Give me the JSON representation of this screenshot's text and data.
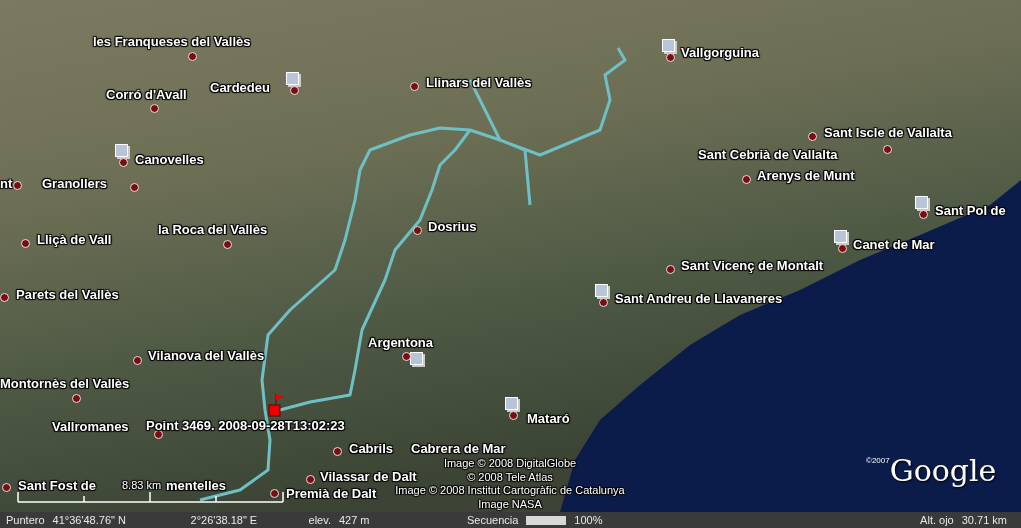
{
  "map": {
    "places": [
      {
        "name": "les Franqueses del Vallès"
      },
      {
        "name": "Corró d'Avall"
      },
      {
        "name": "Cardedeu"
      },
      {
        "name": "Llinars del Vallès"
      },
      {
        "name": "Canovelles"
      },
      {
        "name": "nt"
      },
      {
        "name": "Granollers"
      },
      {
        "name": "Lliçà de Vall"
      },
      {
        "name": "la Roca del Vallès"
      },
      {
        "name": "Dosrius"
      },
      {
        "name": "Vallgorguina"
      },
      {
        "name": "Sant Iscle de Vallalta"
      },
      {
        "name": "Sant Cebrià de Vallalta"
      },
      {
        "name": "Arenys de Munt"
      },
      {
        "name": "Sant Pol de"
      },
      {
        "name": "Canet de Mar"
      },
      {
        "name": "Sant Vicenç de Montalt"
      },
      {
        "name": "Sant Andreu de Llavaneres"
      },
      {
        "name": "Parets del Vallès"
      },
      {
        "name": "Argentona"
      },
      {
        "name": "Vilanova del Vallès"
      },
      {
        "name": "Montornès del Vallès"
      },
      {
        "name": "Vallromanes"
      },
      {
        "name": "Mataró"
      },
      {
        "name": "Cabrils"
      },
      {
        "name": "Cabrera de Mar"
      },
      {
        "name": "Vilassar de Dalt"
      },
      {
        "name": "Sant Fost de"
      },
      {
        "name": "mentelles"
      },
      {
        "name": "Premià de Dalt"
      }
    ],
    "track_point": {
      "label": "Point 3469. 2008-09-28T13:02:23"
    },
    "scale": {
      "label": "8.83 km"
    },
    "attribution": [
      "Image © 2008 DigitalGlobe",
      "© 2008 Tele Atlas",
      "Image © 2008 Institut Cartogràfic de Catalunya",
      "Image NASA"
    ],
    "logo": {
      "year": "©2007",
      "name": "Google"
    }
  },
  "status_bar": {
    "pointer_label": "Puntero",
    "latitude": "41°36'48.76\" N",
    "longitude": "2°26'38.18\" E",
    "elevation_label": "elev.",
    "elevation": "427 m",
    "stream_label": "Secuencia",
    "streaming": {
      "level": 1
    },
    "stream_percent": "100%",
    "eye_alt_label": "Alt. ojo",
    "eye_alt": "30.71 km"
  }
}
